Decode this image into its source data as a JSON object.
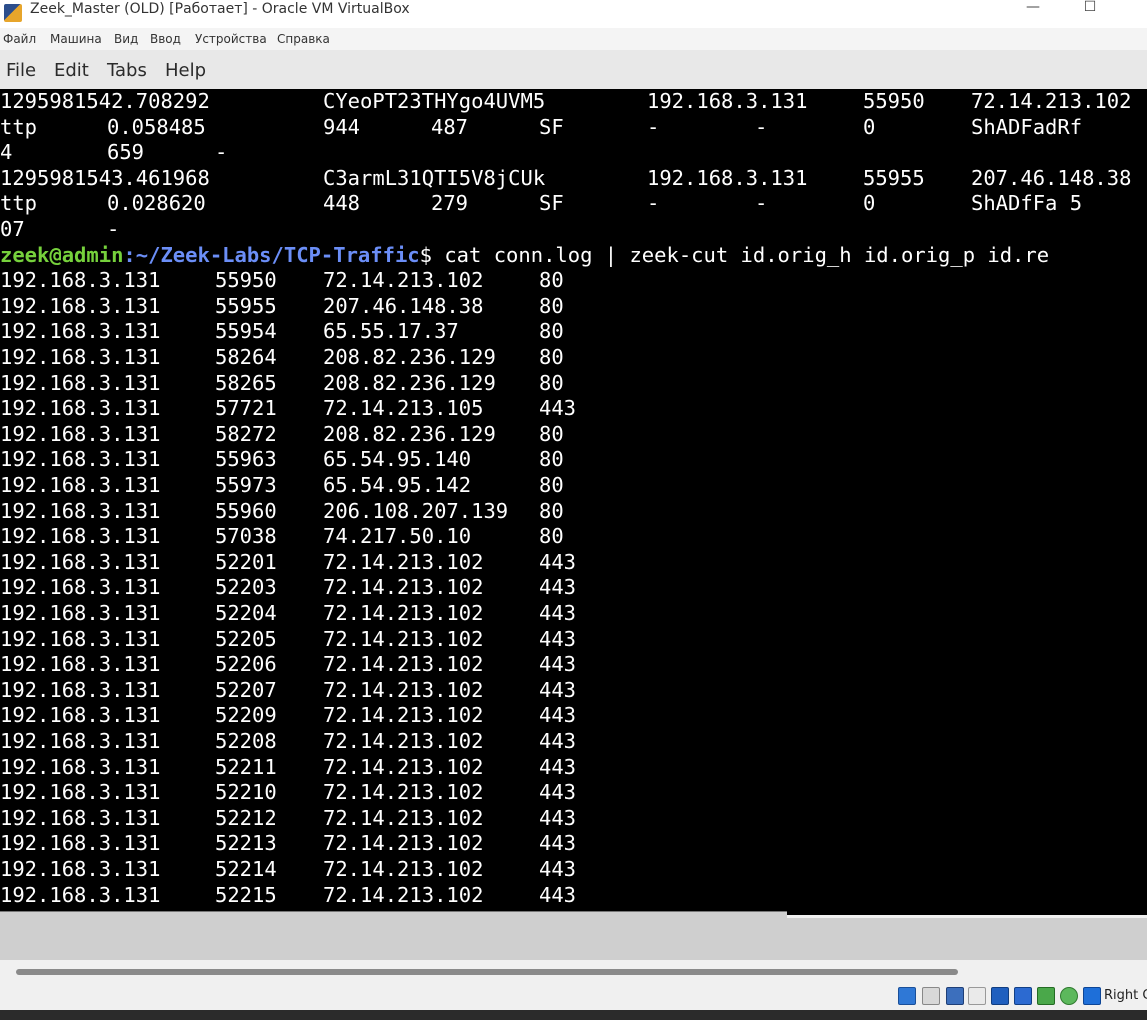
{
  "window": {
    "title": "Zeek_Master (OLD) [Работает] - Oracle VM VirtualBox",
    "minimize_glyph": "—",
    "maximize_glyph": "☐"
  },
  "vbox_menu": [
    "Файл",
    "Машина",
    "Вид",
    "Ввод",
    "Устройства",
    "Справка"
  ],
  "terminal_menu": [
    "File",
    "Edit",
    "Tabs",
    "Help"
  ],
  "prior_output": [
    [
      "1295981542.708292",
      "CYeoPT23THYgo4UVM5",
      "192.168.3.131",
      "55950",
      "72.14.213.102"
    ],
    [
      "ttp",
      "0.058485",
      "944",
      "487",
      "SF",
      "-",
      "-",
      "0",
      "ShADFadRf"
    ],
    [
      "4",
      "659",
      "-"
    ],
    [
      "1295981543.461968",
      "C3armL31QTI5V8jCUk",
      "192.168.3.131",
      "55955",
      "207.46.148.38"
    ],
    [
      "ttp",
      "0.028620",
      "448",
      "279",
      "SF",
      "-",
      "-",
      "0",
      "ShADfFa 5"
    ],
    [
      "07",
      "-"
    ]
  ],
  "prompt": {
    "user_host": "zeek@admin",
    "path": ":~/Zeek-Labs/TCP-Traffic",
    "symbol": "$",
    "command": " cat conn.log | zeek-cut id.orig_h id.orig_p id.re"
  },
  "rows": [
    [
      "192.168.3.131",
      "55950",
      "72.14.213.102",
      "80"
    ],
    [
      "192.168.3.131",
      "55955",
      "207.46.148.38",
      "80"
    ],
    [
      "192.168.3.131",
      "55954",
      "65.55.17.37",
      "80"
    ],
    [
      "192.168.3.131",
      "58264",
      "208.82.236.129",
      "80"
    ],
    [
      "192.168.3.131",
      "58265",
      "208.82.236.129",
      "80"
    ],
    [
      "192.168.3.131",
      "57721",
      "72.14.213.105",
      "443"
    ],
    [
      "192.168.3.131",
      "58272",
      "208.82.236.129",
      "80"
    ],
    [
      "192.168.3.131",
      "55963",
      "65.54.95.140",
      "80"
    ],
    [
      "192.168.3.131",
      "55973",
      "65.54.95.142",
      "80"
    ],
    [
      "192.168.3.131",
      "55960",
      "206.108.207.139",
      "80"
    ],
    [
      "192.168.3.131",
      "57038",
      "74.217.50.10",
      "80"
    ],
    [
      "192.168.3.131",
      "52201",
      "72.14.213.102",
      "443"
    ],
    [
      "192.168.3.131",
      "52203",
      "72.14.213.102",
      "443"
    ],
    [
      "192.168.3.131",
      "52204",
      "72.14.213.102",
      "443"
    ],
    [
      "192.168.3.131",
      "52205",
      "72.14.213.102",
      "443"
    ],
    [
      "192.168.3.131",
      "52206",
      "72.14.213.102",
      "443"
    ],
    [
      "192.168.3.131",
      "52207",
      "72.14.213.102",
      "443"
    ],
    [
      "192.168.3.131",
      "52209",
      "72.14.213.102",
      "443"
    ],
    [
      "192.168.3.131",
      "52208",
      "72.14.213.102",
      "443"
    ],
    [
      "192.168.3.131",
      "52211",
      "72.14.213.102",
      "443"
    ],
    [
      "192.168.3.131",
      "52210",
      "72.14.213.102",
      "443"
    ],
    [
      "192.168.3.131",
      "52212",
      "72.14.213.102",
      "443"
    ],
    [
      "192.168.3.131",
      "52213",
      "72.14.213.102",
      "443"
    ],
    [
      "192.168.3.131",
      "52214",
      "72.14.213.102",
      "443"
    ],
    [
      "192.168.3.131",
      "52215",
      "72.14.213.102",
      "443"
    ]
  ],
  "status_bar": {
    "host_key_label": "Right C",
    "icons": [
      "hard-disk-icon",
      "optical-drive-icon",
      "audio-icon",
      "network-icon",
      "usb-icon",
      "shared-folders-icon",
      "display-icon",
      "recording-icon",
      "mouse-integration-icon",
      "keyboard-capture-icon"
    ]
  },
  "colors": {
    "prompt_user": "#76d13c",
    "prompt_path": "#6b8ef7",
    "terminal_bg": "#000000",
    "terminal_fg": "#ffffff"
  }
}
